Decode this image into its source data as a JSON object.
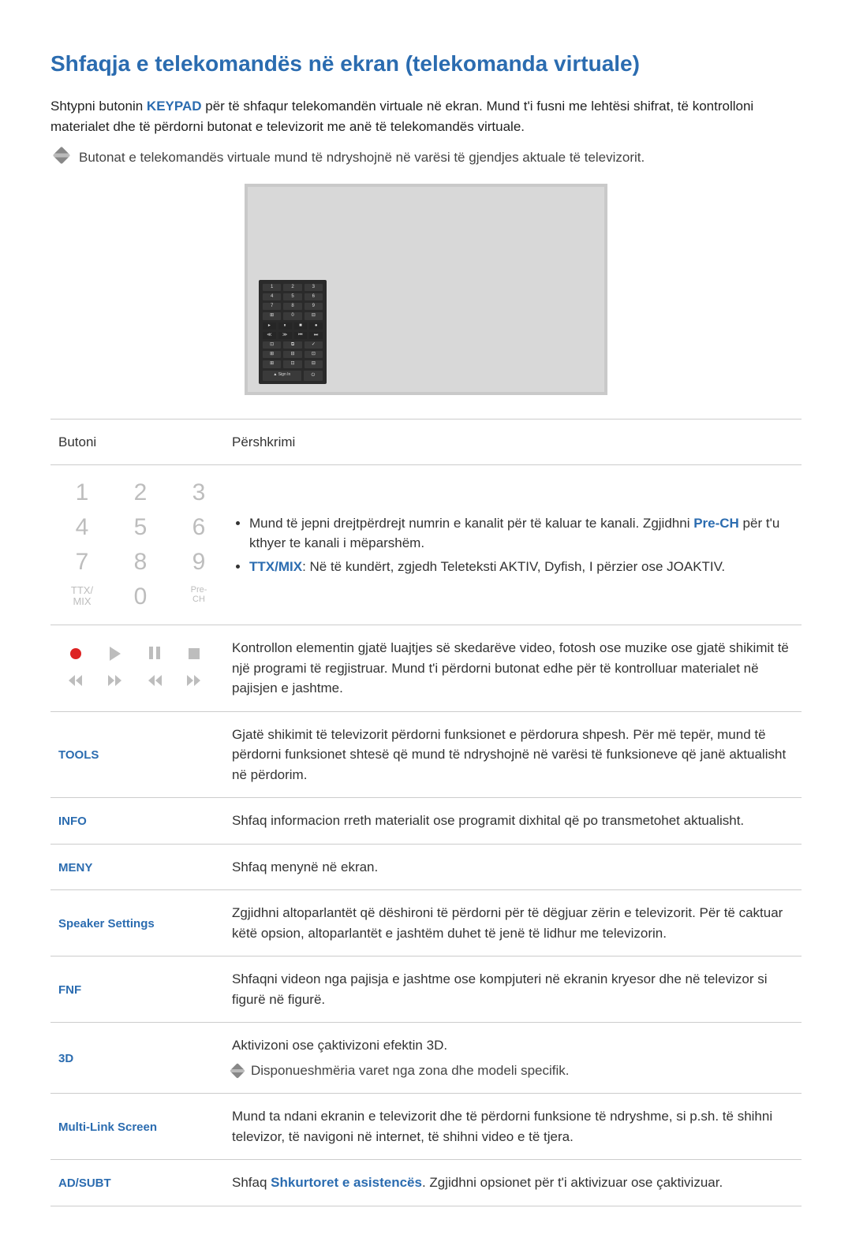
{
  "title": "Shfaqja e telekomandës në ekran (telekomanda virtuale)",
  "intro_pre": "Shtypni butonin ",
  "intro_keypad": "KEYPAD",
  "intro_post": " për të shfaqur telekomandën virtuale në ekran. Mund t'i fusni me lehtësi shifrat, të kontrolloni materialet dhe të përdorni butonat e televizorit me anë të telekomandës virtuale.",
  "note": "Butonat e telekomandës virtuale mund të ndryshojnë në varësi të gjendjes aktuale të televizorit.",
  "headers": {
    "button": "Butoni",
    "desc": "Përshkrimi"
  },
  "keypad": {
    "k1": "1",
    "k2": "2",
    "k3": "3",
    "k4": "4",
    "k5": "5",
    "k6": "6",
    "k7": "7",
    "k8": "8",
    "k9": "9",
    "k0": "0",
    "ttxmix": "TTX/\nMIX",
    "prech": "Pre-\nCH"
  },
  "row_numeric": {
    "li1_pre": "Mund të jepni drejtpërdrejt numrin e kanalit për të kaluar te kanali. Zgjidhni ",
    "li1_link": "Pre-CH",
    "li1_post": " për t'u kthyer te kanali i mëparshëm.",
    "li2_bold": "TTX/MIX",
    "li2_rest": ": Në të kundërt, zgjedh Teleteksti AKTIV, Dyfish, I përzier ose JOAKTIV."
  },
  "row_playback": "Kontrollon elementin gjatë luajtjes së skedarëve video, fotosh ose muzike ose gjatë shikimit të një programi të regjistruar. Mund t'i përdorni butonat edhe për të kontrolluar materialet në pajisjen e jashtme.",
  "rows": {
    "tools": {
      "label": "TOOLS",
      "desc": "Gjatë shikimit të televizorit përdorni funksionet e përdorura shpesh. Për më tepër, mund të përdorni funksionet shtesë që mund të ndryshojnë në varësi të funksioneve që janë aktualisht në përdorim."
    },
    "info": {
      "label": "INFO",
      "desc": "Shfaq informacion rreth materialit ose programit dixhital që po transmetohet aktualisht."
    },
    "meny": {
      "label": "MENY",
      "desc": "Shfaq menynë në ekran."
    },
    "speaker": {
      "label": "Speaker Settings",
      "desc": "Zgjidhni altoparlantët që dëshironi të përdorni për të dëgjuar zërin e televizorit. Për të caktuar këtë opsion, altoparlantët e jashtëm duhet të jenë të lidhur me televizorin."
    },
    "fnf": {
      "label": "FNF",
      "desc": "Shfaqni videon nga pajisja e jashtme ose kompjuteri në ekranin kryesor dhe në televizor si figurë në figurë."
    },
    "threeD": {
      "label": "3D",
      "desc": "Aktivizoni ose çaktivizoni efektin 3D.",
      "note": "Disponueshmëria varet nga zona dhe modeli specifik."
    },
    "multilink": {
      "label": "Multi-Link Screen",
      "desc": "Mund ta ndani ekranin e televizorit dhe të përdorni funksione të ndryshme, si p.sh. të shihni televizor, të navigoni në internet, të shihni video e të tjera."
    },
    "adsubt": {
      "label": "AD/SUBT",
      "desc_pre": "Shfaq ",
      "desc_link": "Shkurtoret e asistencës",
      "desc_post": ". Zgjidhni opsionet për t'i aktivizuar ose çaktivizuar."
    }
  },
  "panel": {
    "signin": "Sign In"
  }
}
